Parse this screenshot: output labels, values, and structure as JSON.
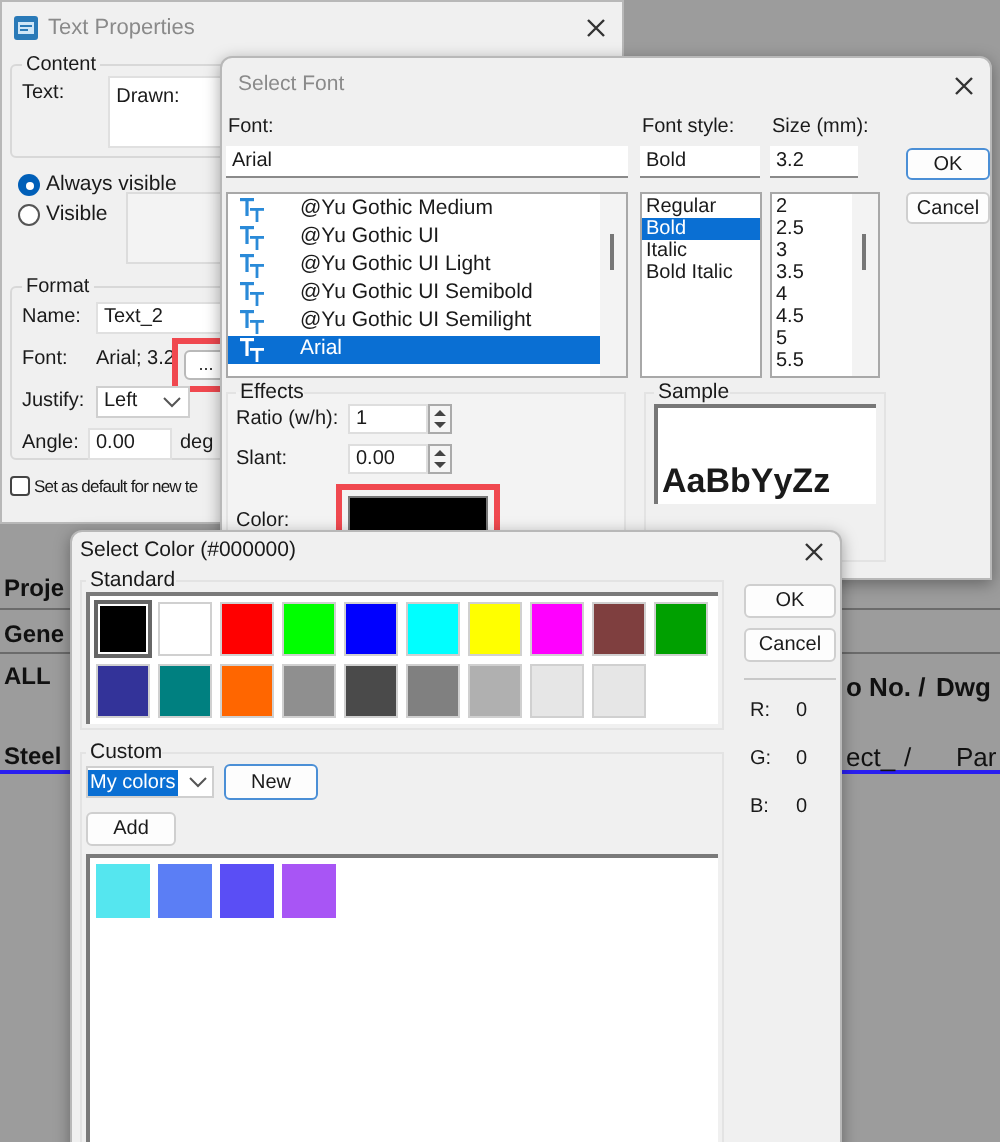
{
  "background": {
    "left_texts": [
      "Proje",
      "Gene",
      "ALL",
      "Steel"
    ],
    "right_texts": [
      "o No. /",
      "Dwg",
      "ect_",
      "/",
      "Par"
    ]
  },
  "text_properties": {
    "title": "Text Properties",
    "content": {
      "group": "Content",
      "text_label": "Text:",
      "text_value": "Drawn:",
      "visibility": [
        {
          "label": "Always visible",
          "selected": true
        },
        {
          "label": "Visible",
          "selected": false
        }
      ]
    },
    "format": {
      "group": "Format",
      "name_label": "Name:",
      "name_value": "Text_2",
      "font_label": "Font:",
      "font_value": "Arial; 3.2",
      "font_button": {
        "label": "...",
        "highlighted": true
      },
      "justify_label": "Justify:",
      "justify_value": "Left",
      "angle_label": "Angle:",
      "angle_value": "0.00",
      "angle_unit": "deg"
    },
    "default_checkbox": {
      "label": "Set as default for new te",
      "checked": false
    }
  },
  "select_font": {
    "title": "Select Font",
    "font_label": "Font:",
    "font_value": "Arial",
    "style_label": "Font style:",
    "style_value": "Bold",
    "size_label": "Size (mm):",
    "size_value": "3.2",
    "fonts": [
      {
        "label": "@Yu Gothic Medium",
        "selected": false
      },
      {
        "label": "@Yu Gothic UI",
        "selected": false
      },
      {
        "label": "@Yu Gothic UI Light",
        "selected": false
      },
      {
        "label": "@Yu Gothic UI Semibold",
        "selected": false
      },
      {
        "label": "@Yu Gothic UI Semilight",
        "selected": false
      },
      {
        "label": "Arial",
        "selected": true
      }
    ],
    "styles": [
      {
        "label": "Regular",
        "selected": false
      },
      {
        "label": "Bold",
        "selected": true
      },
      {
        "label": "Italic",
        "selected": false
      },
      {
        "label": "Bold Italic",
        "selected": false
      }
    ],
    "sizes": [
      {
        "label": "2",
        "selected": false
      },
      {
        "label": "2.5",
        "selected": false
      },
      {
        "label": "3",
        "selected": false
      },
      {
        "label": "3.5",
        "selected": false
      },
      {
        "label": "4",
        "selected": false
      },
      {
        "label": "4.5",
        "selected": false
      },
      {
        "label": "5",
        "selected": false
      },
      {
        "label": "5.5",
        "selected": false
      }
    ],
    "buttons": [
      "OK",
      "Cancel"
    ],
    "effects": {
      "group": "Effects",
      "ratio_label": "Ratio (w/h):",
      "ratio_value": "1",
      "slant_label": "Slant:",
      "slant_value": "0.00",
      "color_label": "Color:",
      "color": "#000000",
      "color_highlighted": true
    },
    "sample": {
      "group": "Sample",
      "text": "AaBbYyZz"
    }
  },
  "select_color": {
    "title": "Select Color (#000000)",
    "standard_group": "Standard",
    "standard": [
      {
        "color": "#000000",
        "selected": true
      },
      {
        "color": "#ffffff",
        "selected": false
      },
      {
        "color": "#ff0000",
        "selected": false
      },
      {
        "color": "#00ff00",
        "selected": false
      },
      {
        "color": "#0000ff",
        "selected": false
      },
      {
        "color": "#00ffff",
        "selected": false
      },
      {
        "color": "#ffff00",
        "selected": false
      },
      {
        "color": "#ff00ff",
        "selected": false
      },
      {
        "color": "#7f3f3f",
        "selected": false
      },
      {
        "color": "#00a000",
        "selected": false
      },
      {
        "color": "#333399",
        "selected": false
      },
      {
        "color": "#008080",
        "selected": false
      },
      {
        "color": "#ff6600",
        "selected": false
      },
      {
        "color": "#8f8f8f",
        "selected": false
      },
      {
        "color": "#4a4a4a",
        "selected": false
      },
      {
        "color": "#808080",
        "selected": false
      },
      {
        "color": "#b0b0b0",
        "selected": false
      },
      {
        "color": "#e6e6e6",
        "selected": false
      },
      {
        "color": "#e6e6e6",
        "selected": false
      }
    ],
    "custom_group": "Custom",
    "palette_value": "My colors",
    "new_button": "New",
    "add_button": "Add",
    "custom": [
      {
        "color": "#55e6ef"
      },
      {
        "color": "#5b7ef5"
      },
      {
        "color": "#5a4ef5"
      },
      {
        "color": "#a855f5"
      }
    ],
    "buttons": [
      "OK",
      "Cancel"
    ],
    "rgb": [
      {
        "label": "R:",
        "value": "0"
      },
      {
        "label": "G:",
        "value": "0"
      },
      {
        "label": "B:",
        "value": "0"
      }
    ]
  }
}
